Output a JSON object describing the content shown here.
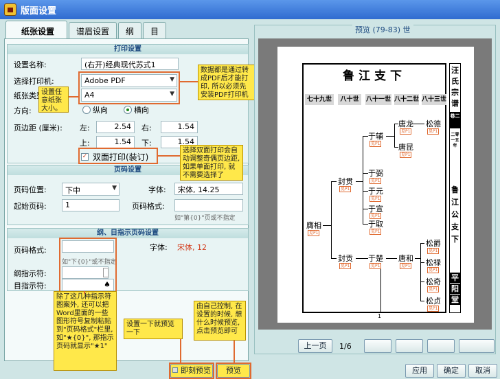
{
  "window": {
    "title": "版面设置"
  },
  "tabs": [
    {
      "label": "纸张设置"
    },
    {
      "label": "谱眉设置"
    },
    {
      "label": "纲"
    },
    {
      "label": "目"
    }
  ],
  "print_section": {
    "header": "打印设置",
    "settings_name_label": "设置名称:",
    "settings_name_value": "(右开)经典现代苏式1",
    "printer_label": "选择打印机:",
    "printer_value": "Adobe PDF",
    "paper_label": "纸张类型",
    "paper_value": "A4",
    "orientation_label": "方向:",
    "orientation_portrait": "纵向",
    "orientation_landscape": "横向",
    "margin_label": "页边距 (厘米):",
    "left_label": "左:",
    "left_value": "2.54",
    "right_label": "右:",
    "right_value": "1.54",
    "top_label": "上:",
    "top_value": "1.54",
    "bottom_label": "下:",
    "bottom_value": "1.54",
    "duplex_label": "双面打印(装订)"
  },
  "pagenum_section": {
    "header": "页码设置",
    "position_label": "页码位置:",
    "position_value": "下中",
    "font_label": "字体:",
    "font_value": "宋体, 14.25",
    "start_label": "起始页码:",
    "start_value": "1",
    "format_label": "页码格式:",
    "format_hint": "如\"第{0}\"页或不指定"
  },
  "outline_section": {
    "header": "纲、目指示页码设置",
    "format_label": "页码格式:",
    "format_hint": "如\"下{0}\"或不指定",
    "font_label": "字体:",
    "font_value": "宋体, 12",
    "outline_label": "纲指示符:",
    "item_label": "目指示符:",
    "item_symbol": "♠"
  },
  "notes": {
    "pdf_note": "数据都是通过转成PDF后才能打印, 所以必须先安装PDF打印机",
    "paper_note": "设置任意纸张大小。",
    "duplex_note": "选择双面打印会自动调整奇偶页边距, 如果单面打印, 就不需要选择了",
    "symbol_note": "除了这几种指示符图案外, 还可以把Word里面的一些图形符号复制粘贴到\"页码格式\"栏里, 如\"★{0}\", 那指示页码就显示\"★1\"",
    "preview_note": "设置一下就预览一下",
    "control_note": "由自己控制, 在设置的时候, 想什么时候预览, 点击预览即可"
  },
  "buttons": {
    "instant_preview": "即刻预览",
    "preview": "预览",
    "apply": "应用",
    "ok": "确定",
    "cancel": "取消",
    "prev_page": "上一页",
    "page_indicator": "1/6"
  },
  "preview": {
    "group_title": "预览 (79-83) 世",
    "main_title": "鲁江支下",
    "side_labels": [
      "汪",
      "氏",
      "宗",
      "谱",
      "卷二",
      "二零一五年",
      "鲁",
      "江",
      "公",
      "支",
      "下",
      "平",
      "阳",
      "堂"
    ],
    "generations": [
      "七十九世",
      "八十世",
      "八十一世",
      "八十二世",
      "八十三世"
    ],
    "persons": {
      "g79": "膺相",
      "g80a": "封贯",
      "g80b": "封贡",
      "g81a": "于辅",
      "g81b": "于弼",
      "g81c": "于元",
      "g81d": "于宣",
      "g81e": "于取",
      "g81f": "于楚",
      "g82a": "唐龙",
      "g82b": "唐昆",
      "g82c": "唐和",
      "g83a": "松德",
      "g83b": "松爵",
      "g83c": "松禄",
      "g83d": "松奇",
      "g83e": "松贞"
    },
    "seal_text": "见P1",
    "page_number": "1"
  }
}
